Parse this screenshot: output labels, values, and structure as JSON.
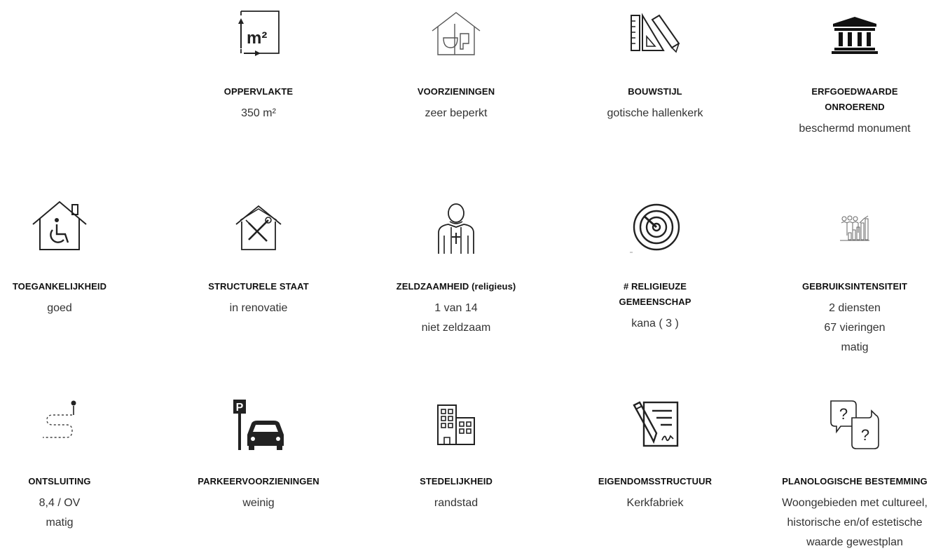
{
  "items": [
    {
      "icon": "area-m2-icon",
      "title": [
        "OPPERVLAKTE"
      ],
      "values": [
        "350 m²"
      ],
      "icon_text": "m²"
    },
    {
      "icon": "house-bathroom-icon",
      "title": [
        "VOORZIENINGEN"
      ],
      "values": [
        "zeer beperkt"
      ]
    },
    {
      "icon": "drafting-tools-icon",
      "title": [
        "BOUWSTIJL"
      ],
      "values": [
        "gotische hallenkerk"
      ]
    },
    {
      "icon": "heritage-building-icon",
      "title": [
        "ERFGOEDWAARDE",
        "ONROEREND"
      ],
      "values": [
        "beschermd monument"
      ]
    },
    {
      "icon": "accessible-house-icon",
      "title": [
        "TOEGANKELIJKHEID"
      ],
      "values": [
        "goed"
      ]
    },
    {
      "icon": "house-repair-icon",
      "title": [
        "STRUCTURELE STAAT"
      ],
      "values": [
        "in renovatie"
      ]
    },
    {
      "icon": "priest-icon",
      "title": [
        "ZELDZAAMHEID (religieus)"
      ],
      "values": [
        "1 van 14",
        "niet zeldzaam"
      ]
    },
    {
      "icon": "radar-icon",
      "title": [
        "# RELIGIEUZE",
        "GEMEENSCHAP"
      ],
      "values": [
        "kana ( 3 )"
      ]
    },
    {
      "icon": "usage-chart-icon",
      "title": [
        "GEBRUIKSINTENSITEIT"
      ],
      "values": [
        "2 diensten",
        "67 vieringen",
        "matig"
      ]
    },
    {
      "icon": "route-icon",
      "title": [
        "ONTSLUITING"
      ],
      "values": [
        "8,4 / OV",
        "matig"
      ]
    },
    {
      "icon": "parking-car-icon",
      "title": [
        "PARKEERVOORZIENINGEN"
      ],
      "values": [
        "weinig"
      ],
      "icon_text": "P"
    },
    {
      "icon": "city-buildings-icon",
      "title": [
        "STEDELIJKHEID"
      ],
      "values": [
        "randstad"
      ]
    },
    {
      "icon": "document-sign-icon",
      "title": [
        "EIGENDOMSSTRUCTUUR"
      ],
      "values": [
        "Kerkfabriek"
      ]
    },
    {
      "icon": "question-bubbles-icon",
      "title": [
        "PLANOLOGISCHE BESTEMMING"
      ],
      "values": [
        "Woongebieden met cultureel,",
        "historische en/of estetische",
        "waarde gewestplan"
      ],
      "icon_text": "?"
    }
  ]
}
